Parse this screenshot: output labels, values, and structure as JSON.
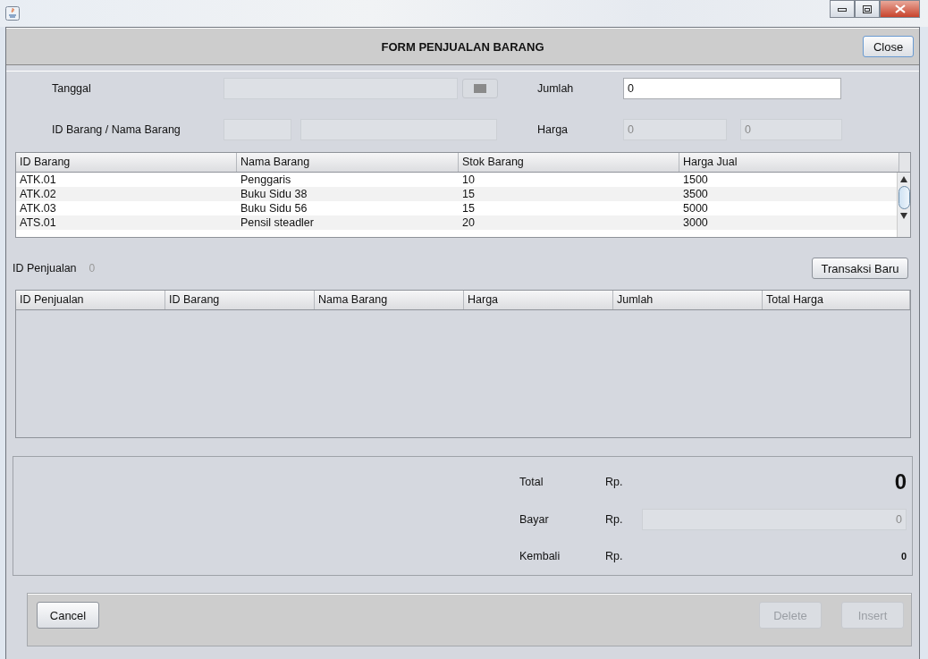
{
  "window": {
    "title": "FORM PENJUALAN BARANG",
    "close_button": "Close"
  },
  "form": {
    "tanggal": {
      "label": "Tanggal"
    },
    "jumlah": {
      "label": "Jumlah",
      "value": "0"
    },
    "barang": {
      "label": "ID Barang / Nama Barang"
    },
    "harga": {
      "label": "Harga",
      "value_1": "0",
      "value_2": "0"
    }
  },
  "stock_table": {
    "columns": [
      "ID Barang",
      "Nama Barang",
      "Stok Barang",
      "Harga Jual"
    ],
    "rows": [
      [
        "ATK.01",
        "Penggaris",
        "10",
        "1500"
      ],
      [
        "ATK.02",
        "Buku Sidu 38",
        "15",
        "3500"
      ],
      [
        "ATK.03",
        "Buku Sidu 56",
        "15",
        "5000"
      ],
      [
        "ATS.01",
        "Pensil steadler",
        "20",
        "3000"
      ]
    ]
  },
  "id_penjualan": {
    "label": "ID Penjualan",
    "value": "0"
  },
  "new_transaction_button": "Transaksi Baru",
  "sales_table": {
    "columns": [
      "ID Penjualan",
      "ID Barang",
      "Nama Barang",
      "Harga",
      "Jumlah",
      "Total Harga"
    ]
  },
  "summary": {
    "total": {
      "label": "Total",
      "currency": "Rp.",
      "value": "0"
    },
    "bayar": {
      "label": "Bayar",
      "currency": "Rp.",
      "value": "0"
    },
    "kembali": {
      "label": "Kembali",
      "currency": "Rp.",
      "value": "0"
    }
  },
  "buttons": [
    {
      "label": "Cancel",
      "disabled": false
    },
    {
      "label": "Delete",
      "disabled": true
    },
    {
      "label": "Insert",
      "disabled": true
    }
  ]
}
